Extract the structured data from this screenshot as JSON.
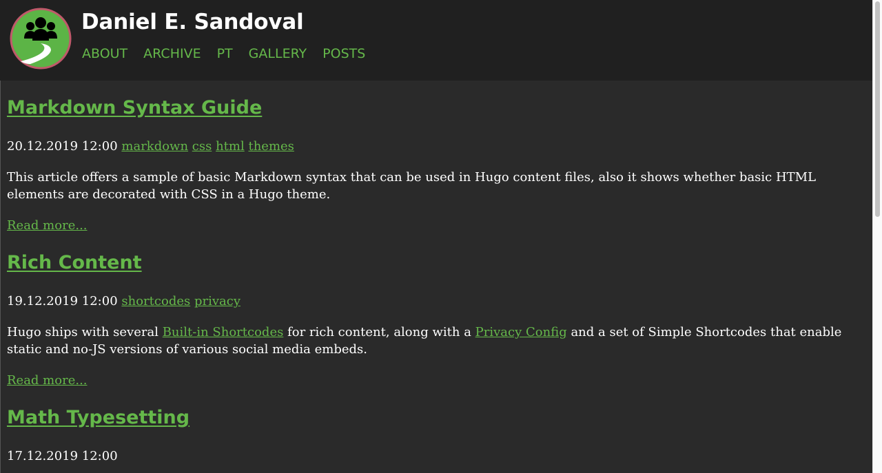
{
  "site": {
    "title": "Daniel E. Sandoval",
    "nav": [
      "ABOUT",
      "ARCHIVE",
      "PT",
      "GALLERY",
      "POSTS"
    ]
  },
  "posts": [
    {
      "title": "Markdown Syntax Guide",
      "date": "20.12.2019 12:00",
      "tags": [
        "markdown",
        "css",
        "html",
        "themes"
      ],
      "summary": "This article offers a sample of basic Markdown syntax that can be used in Hugo content files, also it shows whether basic HTML elements are decorated with CSS in a Hugo theme.",
      "read_more": "Read more..."
    },
    {
      "title": "Rich Content",
      "date": "19.12.2019 12:00",
      "tags": [
        "shortcodes",
        "privacy"
      ],
      "summary_parts": [
        "Hugo ships with several ",
        "Built-in Shortcodes",
        " for rich content, along with a ",
        "Privacy Config",
        " and a set of Simple Shortcodes that enable static and no-JS versions of various social media embeds."
      ],
      "read_more": "Read more..."
    },
    {
      "title": "Math Typesetting",
      "date": "17.12.2019 12:00"
    }
  ],
  "colors": {
    "accent": "#65b84a",
    "background": "#2a2a2a",
    "header": "#202020"
  },
  "icons": {
    "logo": "people-road-logo-icon"
  }
}
